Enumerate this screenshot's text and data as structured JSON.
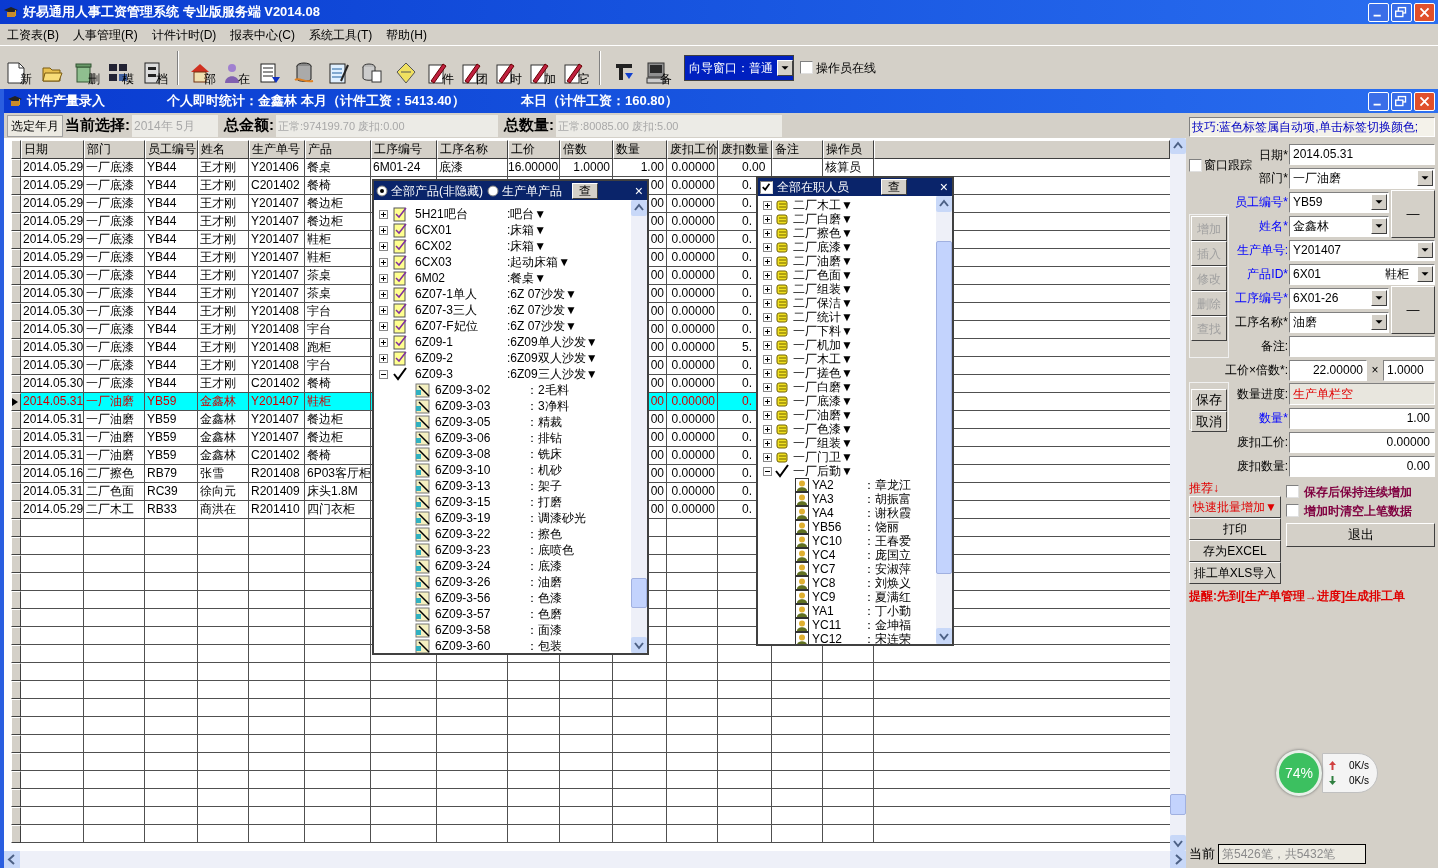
{
  "window": {
    "title": "好易通用人事工资管理系统 专业版服务端 V2014.08"
  },
  "menu": [
    "工资表(B)",
    "人事管理(R)",
    "计件计时(D)",
    "报表中心(C)",
    "系统工具(T)",
    "帮助(H)"
  ],
  "toolbar": [
    {
      "kind": "new",
      "label": "新"
    },
    {
      "kind": "open"
    },
    {
      "kind": "delete",
      "label": "删"
    },
    {
      "kind": "template",
      "label": "模"
    },
    {
      "kind": "archive",
      "label": "档"
    },
    {
      "kind": "separator"
    },
    {
      "kind": "house",
      "label": "部"
    },
    {
      "kind": "person",
      "label": "在"
    },
    {
      "kind": "list"
    },
    {
      "kind": "database"
    },
    {
      "kind": "report"
    },
    {
      "kind": "copy"
    },
    {
      "kind": "diamond"
    },
    {
      "kind": "piece",
      "label": "件"
    },
    {
      "kind": "piece",
      "label": "团"
    },
    {
      "kind": "piece",
      "label": "时"
    },
    {
      "kind": "piece",
      "label": "加"
    },
    {
      "kind": "piece",
      "label": "它"
    },
    {
      "kind": "separator"
    },
    {
      "kind": "import"
    },
    {
      "kind": "computer",
      "label": "备"
    }
  ],
  "wizard_select": {
    "value": "向导窗口：普通"
  },
  "operator_online": {
    "label": "操作员在线",
    "checked": false
  },
  "child_window": {
    "title": "计件产量录入",
    "stats_person": "个人即时统计：金鑫林 本月（计件工资：5413.40）",
    "stats_today": "本日（计件工资：160.80）"
  },
  "summary": {
    "button": "选定年月",
    "current_label": "当前选择:",
    "current_value": "2014年 5月",
    "amount_label": "总金额:",
    "amount_value": "正常:974199.70 废扣:0.00",
    "qty_label": "总数量:",
    "qty_value": "正常:80085.00 废扣:5.00"
  },
  "table": {
    "columns": [
      "日期",
      "部门",
      "员工编号",
      "姓名",
      "生产单号",
      "产品",
      "工序编号",
      "工序名称",
      "工价",
      "倍数",
      "数量",
      "废扣工价",
      "废扣数量",
      "备注",
      "操作员"
    ],
    "rows": [
      {
        "selected": false,
        "date": "2014.05.29",
        "dept": "一厂底漆",
        "emp_id": "YB44",
        "name": "王才刚",
        "order_no": "Y201406",
        "product": "餐桌",
        "proc_no": "6M01-24",
        "proc_name": "底漆",
        "price": "16.00000",
        "factor": "1.0000",
        "qty": "1.00",
        "scrap_price": "0.00000",
        "scrap_qty": "0.00",
        "operator": "核算员"
      },
      {
        "selected": false,
        "date": "2014.05.29",
        "dept": "一厂底漆",
        "emp_id": "YB44",
        "name": "王才刚",
        "order_no": "C201402",
        "product": "餐椅",
        "qty": "00",
        "scrap_price": "0.00000",
        "scrap_qty": "0."
      },
      {
        "selected": false,
        "date": "2014.05.29",
        "dept": "一厂底漆",
        "emp_id": "YB44",
        "name": "王才刚",
        "order_no": "Y201407",
        "product": "餐边柜",
        "qty": "00",
        "scrap_price": "0.00000",
        "scrap_qty": "0."
      },
      {
        "selected": false,
        "date": "2014.05.29",
        "dept": "一厂底漆",
        "emp_id": "YB44",
        "name": "王才刚",
        "order_no": "Y201407",
        "product": "餐边柜",
        "qty": "00",
        "scrap_price": "0.00000",
        "scrap_qty": "0."
      },
      {
        "selected": false,
        "date": "2014.05.29",
        "dept": "一厂底漆",
        "emp_id": "YB44",
        "name": "王才刚",
        "order_no": "Y201407",
        "product": "鞋柜",
        "qty": "00",
        "scrap_price": "0.00000",
        "scrap_qty": "0."
      },
      {
        "selected": false,
        "date": "2014.05.29",
        "dept": "一厂底漆",
        "emp_id": "YB44",
        "name": "王才刚",
        "order_no": "Y201407",
        "product": "鞋柜",
        "qty": "00",
        "scrap_price": "0.00000",
        "scrap_qty": "0."
      },
      {
        "selected": false,
        "date": "2014.05.30",
        "dept": "一厂底漆",
        "emp_id": "YB44",
        "name": "王才刚",
        "order_no": "Y201407",
        "product": "茶桌",
        "qty": "00",
        "scrap_price": "0.00000",
        "scrap_qty": "0."
      },
      {
        "selected": false,
        "date": "2014.05.30",
        "dept": "一厂底漆",
        "emp_id": "YB44",
        "name": "王才刚",
        "order_no": "Y201407",
        "product": "茶桌",
        "qty": "00",
        "scrap_price": "0.00000",
        "scrap_qty": "0."
      },
      {
        "selected": false,
        "date": "2014.05.30",
        "dept": "一厂底漆",
        "emp_id": "YB44",
        "name": "王才刚",
        "order_no": "Y201408",
        "product": "宇台",
        "qty": "00",
        "scrap_price": "0.00000",
        "scrap_qty": "0."
      },
      {
        "selected": false,
        "date": "2014.05.30",
        "dept": "一厂底漆",
        "emp_id": "YB44",
        "name": "王才刚",
        "order_no": "Y201408",
        "product": "宇台",
        "qty": "00",
        "scrap_price": "0.00000",
        "scrap_qty": "0."
      },
      {
        "selected": false,
        "date": "2014.05.30",
        "dept": "一厂底漆",
        "emp_id": "YB44",
        "name": "王才刚",
        "order_no": "Y201408",
        "product": "跑柜",
        "qty": "00",
        "scrap_price": "0.00000",
        "scrap_qty": "5."
      },
      {
        "selected": false,
        "date": "2014.05.30",
        "dept": "一厂底漆",
        "emp_id": "YB44",
        "name": "王才刚",
        "order_no": "Y201408",
        "product": "宇台",
        "qty": "00",
        "scrap_price": "0.00000",
        "scrap_qty": "0."
      },
      {
        "selected": false,
        "date": "2014.05.30",
        "dept": "一厂底漆",
        "emp_id": "YB44",
        "name": "王才刚",
        "order_no": "C201402",
        "product": "餐椅",
        "qty": "00",
        "scrap_price": "0.00000",
        "scrap_qty": "0."
      },
      {
        "selected": true,
        "date": "2014.05.31",
        "dept": "一厂油磨",
        "emp_id": "YB59",
        "name": "金鑫林",
        "order_no": "Y201407",
        "product": "鞋柜",
        "qty": "00",
        "scrap_price": "0.00000",
        "scrap_qty": "0."
      },
      {
        "selected": false,
        "date": "2014.05.31",
        "dept": "一厂油磨",
        "emp_id": "YB59",
        "name": "金鑫林",
        "order_no": "Y201407",
        "product": "餐边柜",
        "qty": "00",
        "scrap_price": "0.00000",
        "scrap_qty": "0."
      },
      {
        "selected": false,
        "date": "2014.05.31",
        "dept": "一厂油磨",
        "emp_id": "YB59",
        "name": "金鑫林",
        "order_no": "Y201407",
        "product": "餐边柜",
        "qty": "00",
        "scrap_price": "0.00000",
        "scrap_qty": "0."
      },
      {
        "selected": false,
        "date": "2014.05.31",
        "dept": "一厂油磨",
        "emp_id": "YB59",
        "name": "金鑫林",
        "order_no": "C201402",
        "product": "餐椅",
        "qty": "00",
        "scrap_price": "0.00000",
        "scrap_qty": "0."
      },
      {
        "selected": false,
        "date": "2014.05.16",
        "dept": "二厂擦色",
        "emp_id": "RB79",
        "name": "张雪",
        "order_no": "R201408",
        "product": "6P03客厅柜",
        "qty": "00",
        "scrap_price": "0.00000",
        "scrap_qty": "0."
      },
      {
        "selected": false,
        "date": "2014.05.31",
        "dept": "二厂色面",
        "emp_id": "RC39",
        "name": "徐向元",
        "order_no": "R201409",
        "product": "床头1.8M",
        "qty": "00",
        "scrap_price": "0.00000",
        "scrap_qty": "0."
      },
      {
        "selected": false,
        "date": "2014.05.29",
        "dept": "二厂木工",
        "emp_id": "RB33",
        "name": "商洪在",
        "order_no": "R201410",
        "product": "四门衣柜",
        "qty": "00",
        "scrap_price": "0.00000",
        "scrap_qty": "0."
      }
    ]
  },
  "product_picker": {
    "options": [
      {
        "label": "全部产品(非隐藏)",
        "selected": true
      },
      {
        "label": "生产单产品",
        "selected": false
      }
    ],
    "search_button": "查",
    "close": "×",
    "items": [
      {
        "code": "5H21吧台",
        "name": ":吧台▼",
        "expanded": false
      },
      {
        "code": "6CX01",
        "name": ":床箱▼",
        "expanded": false
      },
      {
        "code": "6CX02",
        "name": ":床箱▼",
        "expanded": false
      },
      {
        "code": "6CX03",
        "name": ":起动床箱▼",
        "expanded": false
      },
      {
        "code": "6M02",
        "name": ":餐桌▼",
        "expanded": false
      },
      {
        "code": "6Z07-1单人",
        "name": ":6Z 07沙发▼",
        "expanded": false
      },
      {
        "code": "6Z07-3三人",
        "name": ":6Z 07沙发▼",
        "expanded": false
      },
      {
        "code": "6Z07-F妃位",
        "name": ":6Z 07沙发▼",
        "expanded": false
      },
      {
        "code": "6Z09-1",
        "name": ":6Z09单人沙发▼",
        "expanded": false
      },
      {
        "code": "6Z09-2",
        "name": ":6Z09双人沙发▼",
        "expanded": false
      },
      {
        "code": "6Z09-3",
        "name": ":6Z09三人沙发▼",
        "expanded": true,
        "children": [
          {
            "code": "6Z09-3-02",
            "name": "：2毛料"
          },
          {
            "code": "6Z09-3-03",
            "name": "：3净料"
          },
          {
            "code": "6Z09-3-05",
            "name": "：精裁"
          },
          {
            "code": "6Z09-3-06",
            "name": "：排钻"
          },
          {
            "code": "6Z09-3-08",
            "name": "：铣床"
          },
          {
            "code": "6Z09-3-10",
            "name": "：机砂"
          },
          {
            "code": "6Z09-3-13",
            "name": "：架子"
          },
          {
            "code": "6Z09-3-15",
            "name": "：打磨"
          },
          {
            "code": "6Z09-3-19",
            "name": "：调漆砂光"
          },
          {
            "code": "6Z09-3-22",
            "name": "：擦色"
          },
          {
            "code": "6Z09-3-23",
            "name": "：底喷色"
          },
          {
            "code": "6Z09-3-24",
            "name": "：底漆"
          },
          {
            "code": "6Z09-3-26",
            "name": "：油磨"
          },
          {
            "code": "6Z09-3-56",
            "name": "：色漆"
          },
          {
            "code": "6Z09-3-57",
            "name": "：色磨"
          },
          {
            "code": "6Z09-3-58",
            "name": "：面漆"
          },
          {
            "code": "6Z09-3-60",
            "name": "：包装"
          }
        ]
      }
    ]
  },
  "staff_picker": {
    "all_checked": true,
    "title": "全部在职人员",
    "search_button": "查",
    "close": "×",
    "items": [
      {
        "name": "二厂木工▼",
        "expanded": false
      },
      {
        "name": "二厂白磨▼",
        "expanded": false
      },
      {
        "name": "二厂擦色▼",
        "expanded": false
      },
      {
        "name": "二厂底漆▼",
        "expanded": false
      },
      {
        "name": "二厂油磨▼",
        "expanded": false
      },
      {
        "name": "二厂色面▼",
        "expanded": false
      },
      {
        "name": "二厂组装▼",
        "expanded": false
      },
      {
        "name": "二厂保洁▼",
        "expanded": false
      },
      {
        "name": "二厂统计▼",
        "expanded": false
      },
      {
        "name": "一厂下料▼",
        "expanded": false
      },
      {
        "name": "一厂机加▼",
        "expanded": false
      },
      {
        "name": "一厂木工▼",
        "expanded": false
      },
      {
        "name": "一厂搓色▼",
        "expanded": false
      },
      {
        "name": "一厂白磨▼",
        "expanded": false
      },
      {
        "name": "一厂底漆▼",
        "expanded": false
      },
      {
        "name": "一厂油磨▼",
        "expanded": false
      },
      {
        "name": "一厂色漆▼",
        "expanded": false
      },
      {
        "name": "一厂组装▼",
        "expanded": false
      },
      {
        "name": "一厂门卫▼",
        "expanded": false
      },
      {
        "name": "一厂后勤▼",
        "expanded": true,
        "children": [
          {
            "code": "YA2",
            "name": "：章龙江"
          },
          {
            "code": "YA3",
            "name": "：胡振富"
          },
          {
            "code": "YA4",
            "name": "：谢秋霞"
          },
          {
            "code": "YB56",
            "name": "：饶丽"
          },
          {
            "code": "YC10",
            "name": "：王春爱"
          },
          {
            "code": "YC4",
            "name": "：庞国立"
          },
          {
            "code": "YC7",
            "name": "：安淑萍"
          },
          {
            "code": "YC8",
            "name": "：刘焕义"
          },
          {
            "code": "YC9",
            "name": "：夏满红"
          },
          {
            "code": "YA1",
            "name": "：丁小勤"
          },
          {
            "code": "YC11",
            "name": "：金坤福"
          },
          {
            "code": "YC12",
            "name": "：宋连荣"
          }
        ]
      }
    ]
  },
  "tip": "技巧:蓝色标签属自动项,单击标签切换颜色;",
  "window_follow": {
    "label": "窗口跟踪",
    "checked": false
  },
  "form": [
    {
      "label": "日期*",
      "kind": "text",
      "value": "2014.05.31",
      "auto": false
    },
    {
      "label": "部门*",
      "kind": "select",
      "value": "一厂油磨",
      "auto": false
    },
    {
      "label": "员工编号*",
      "kind": "select",
      "value": "YB59",
      "auto": true,
      "side_button": "—"
    },
    {
      "label": "姓名*",
      "kind": "select",
      "value": "金鑫林",
      "auto": true
    },
    {
      "label": "生产单号:",
      "kind": "select",
      "value": "Y201407",
      "auto": true
    },
    {
      "label": "产品ID*",
      "kind": "select",
      "value": "6X01",
      "extra": "鞋柜",
      "auto": true
    },
    {
      "label": "工序编号*",
      "kind": "select",
      "value": "6X01-26",
      "auto": true,
      "side_button": "—"
    },
    {
      "label": "工序名称*",
      "kind": "select",
      "value": "油磨",
      "auto": false
    },
    {
      "label": "备注:",
      "kind": "text",
      "auto": false
    },
    {
      "label": "工价×倍数*:",
      "kind": "pair",
      "value": "22.00000",
      "sep": "×",
      "value2": "1.0000",
      "auto": false
    },
    {
      "label": "数量进度:",
      "kind": "status",
      "value": "生产单栏空",
      "auto": false
    },
    {
      "label": "数量*",
      "kind": "number",
      "value": "1.00",
      "auto": true
    },
    {
      "label": "废扣工价:",
      "kind": "number",
      "value": "0.00000",
      "auto": false
    },
    {
      "label": "废扣数量:",
      "kind": "number",
      "value": "0.00",
      "auto": false
    }
  ],
  "edit_buttons": [
    {
      "label": "增加",
      "disabled": true
    },
    {
      "label": "插入",
      "disabled": true
    },
    {
      "label": "修改",
      "disabled": true
    },
    {
      "label": "删除",
      "disabled": true
    },
    {
      "label": "查找",
      "disabled": true
    }
  ],
  "save_buttons": [
    {
      "label": "保存",
      "disabled": false
    },
    {
      "label": "取消",
      "disabled": false
    }
  ],
  "recommend": "推荐↓",
  "actions": [
    {
      "label": "快速批量增加▼",
      "kind": "highlight"
    },
    {
      "label": "打印",
      "kind": "normal"
    },
    {
      "label": "存为EXCEL",
      "kind": "normal"
    },
    {
      "label": "排工单XLS导入",
      "kind": "normal"
    }
  ],
  "options": [
    {
      "label": "保存后保持连续增加",
      "checked": false
    },
    {
      "label": "增加时清空上笔数据",
      "checked": false
    }
  ],
  "exit_button": "退出",
  "reminder": "提醒:先到[生产单管理→进度]生成排工单",
  "record_position": {
    "label": "当前",
    "value": "第5426笔，共5432笔"
  },
  "net_widget": {
    "percent": "74%",
    "up": "0K/s",
    "down": "0K/s"
  }
}
